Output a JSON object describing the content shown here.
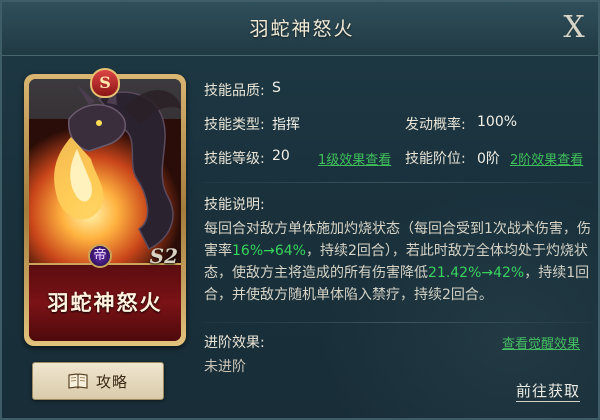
{
  "header": {
    "title": "羽蛇神怒火",
    "close_label": "X"
  },
  "card": {
    "name": "羽蛇神怒火",
    "grade": "S",
    "level_mark": "S2",
    "emblem_glyph": "帝"
  },
  "guide_button": {
    "label": "攻略",
    "icon": "book-icon"
  },
  "info": {
    "quality_label": "技能品质:",
    "quality_value": "S",
    "type_label": "技能类型:",
    "type_value": "指挥",
    "chance_label": "发动概率:",
    "chance_value": "100%",
    "level_label": "技能等级:",
    "level_value": "20",
    "level_link": "1级效果查看",
    "tier_label": "技能阶位:",
    "tier_value": "0阶",
    "tier_link": "2阶效果查看"
  },
  "description": {
    "label": "技能说明:",
    "part1": "每回合对敌方单体施加灼烧状态（每回合受到1次战术伤害，伤害率",
    "hl1": "16%→64%",
    "part2": "，持续2回合），若此时敌方全体均处于灼烧状态，使敌方主将造成的所有伤害降低",
    "hl2": "21.42%→42%",
    "part3": "，持续1回合，并使敌方随机单体陷入禁疗，持续2回合。"
  },
  "advance": {
    "label": "进阶效果:",
    "link": "查看觉醒效果",
    "status": "未进阶"
  },
  "goto_label": "前往获取",
  "colors": {
    "highlight": "#35d45a",
    "link": "#3fc05a",
    "card_name_bg": "#7a1216",
    "frame_gold": "#d9b671"
  }
}
